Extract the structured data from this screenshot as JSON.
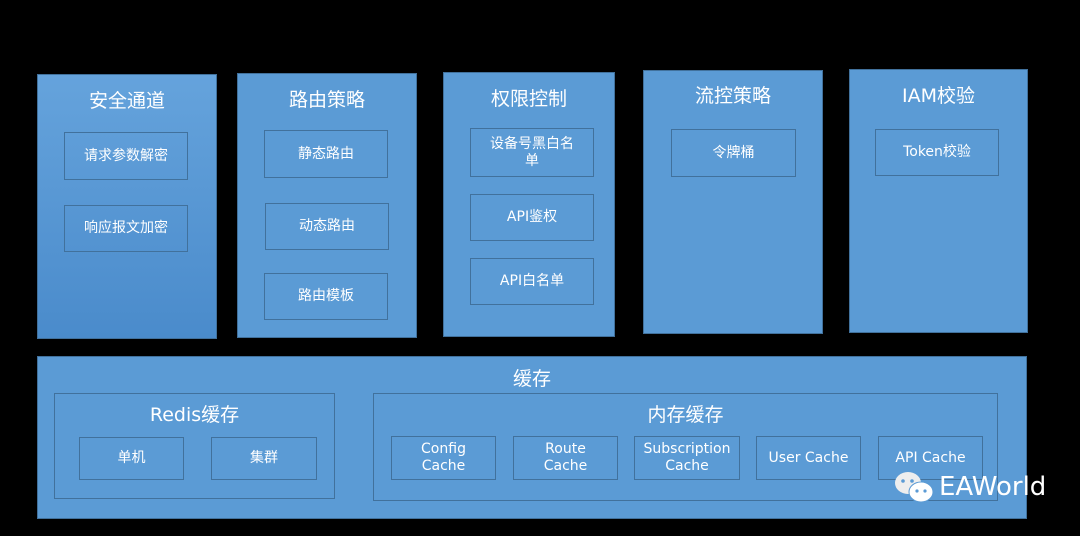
{
  "modules": [
    {
      "title": "安全通道",
      "items": [
        "请求参数解密",
        "响应报文加密"
      ]
    },
    {
      "title": "路由策略",
      "items": [
        "静态路由",
        "动态路由",
        "路由模板"
      ]
    },
    {
      "title": "权限控制",
      "items": [
        "设备号黑白名单",
        "API鉴权",
        "API白名单"
      ]
    },
    {
      "title": "流控策略",
      "items": [
        "令牌桶"
      ]
    },
    {
      "title": "IAM校验",
      "items": [
        "Token校验"
      ]
    }
  ],
  "cache": {
    "title": "缓存",
    "redis": {
      "title": "Redis缓存",
      "items": [
        "单机",
        "集群"
      ]
    },
    "memory": {
      "title": "内存缓存",
      "items": [
        "Config Cache",
        "Route Cache",
        "Subscription Cache",
        "User Cache",
        "API Cache"
      ]
    }
  },
  "watermark": {
    "text": "EAWorld",
    "icon": "wechat-icon"
  }
}
